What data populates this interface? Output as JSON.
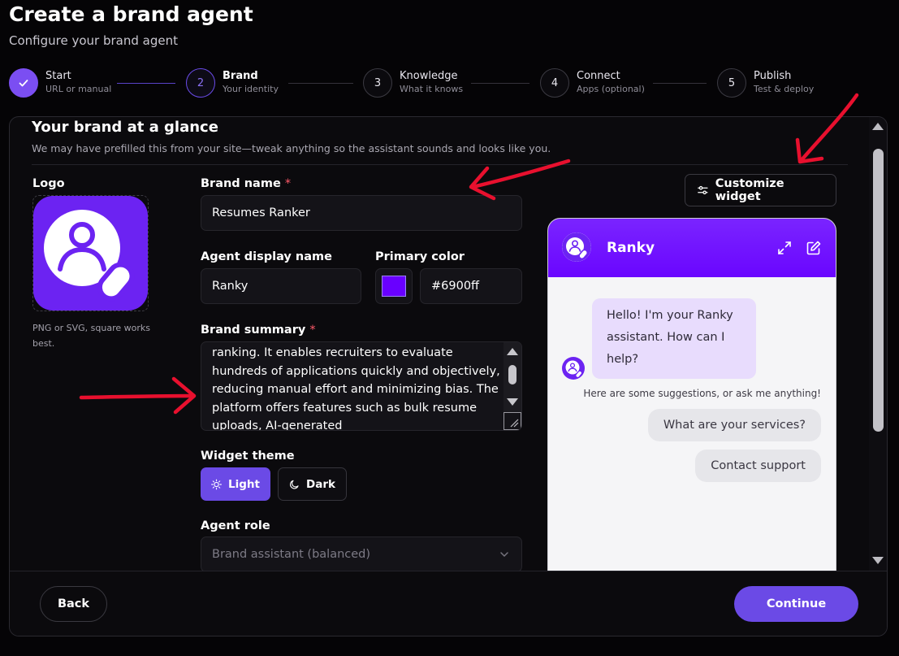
{
  "page": {
    "title": "Create a brand agent",
    "subtitle": "Configure your brand agent"
  },
  "steps": [
    {
      "number": "✓",
      "label": "Start",
      "sub": "URL or manual",
      "state": "done"
    },
    {
      "number": "2",
      "label": "Brand",
      "sub": "Your identity",
      "state": "active"
    },
    {
      "number": "3",
      "label": "Knowledge",
      "sub": "What it knows",
      "state": "todo"
    },
    {
      "number": "4",
      "label": "Connect",
      "sub": "Apps (optional)",
      "state": "todo"
    },
    {
      "number": "5",
      "label": "Publish",
      "sub": "Test & deploy",
      "state": "todo"
    }
  ],
  "card": {
    "title": "Your brand at a glance",
    "description": "We may have prefilled this from your site—tweak anything so the assistant sounds and looks like you."
  },
  "logo": {
    "label": "Logo",
    "hint": "PNG or SVG, square works best."
  },
  "form": {
    "brand_name_label": "Brand name",
    "brand_name_value": "Resumes Ranker",
    "required_mark": "*",
    "agent_display_name_label": "Agent display name",
    "agent_display_name_value": "Ranky",
    "primary_color_label": "Primary color",
    "primary_color_value": "#6900ff",
    "brand_summary_label": "Brand summary",
    "brand_summary_value": "ranking. It enables recruiters to evaluate hundreds of applications quickly and objectively, reducing manual effort and minimizing bias. The platform offers features such as bulk resume uploads, AI-generated",
    "widget_theme_label": "Widget theme",
    "theme_light": "Light",
    "theme_dark": "Dark",
    "agent_role_label": "Agent role",
    "agent_role_value": "Brand assistant (balanced)"
  },
  "widget": {
    "customize_label": "Customize widget",
    "agent_name": "Ranky",
    "greeting": "Hello! I'm your Ranky assistant. How can I help?",
    "suggestions_hint": "Here are some suggestions, or ask me anything!",
    "chips": [
      "What are your services?",
      "Contact support"
    ]
  },
  "footer": {
    "back": "Back",
    "continue": "Continue"
  },
  "colors": {
    "accent": "#6b4ae6",
    "brand": "#6900ff",
    "annotation": "#e8102e"
  },
  "icons": [
    "check-icon",
    "sliders-icon",
    "sun-icon",
    "moon-icon",
    "chevron-down-icon",
    "expand-icon",
    "edit-icon",
    "user-search-icon"
  ]
}
